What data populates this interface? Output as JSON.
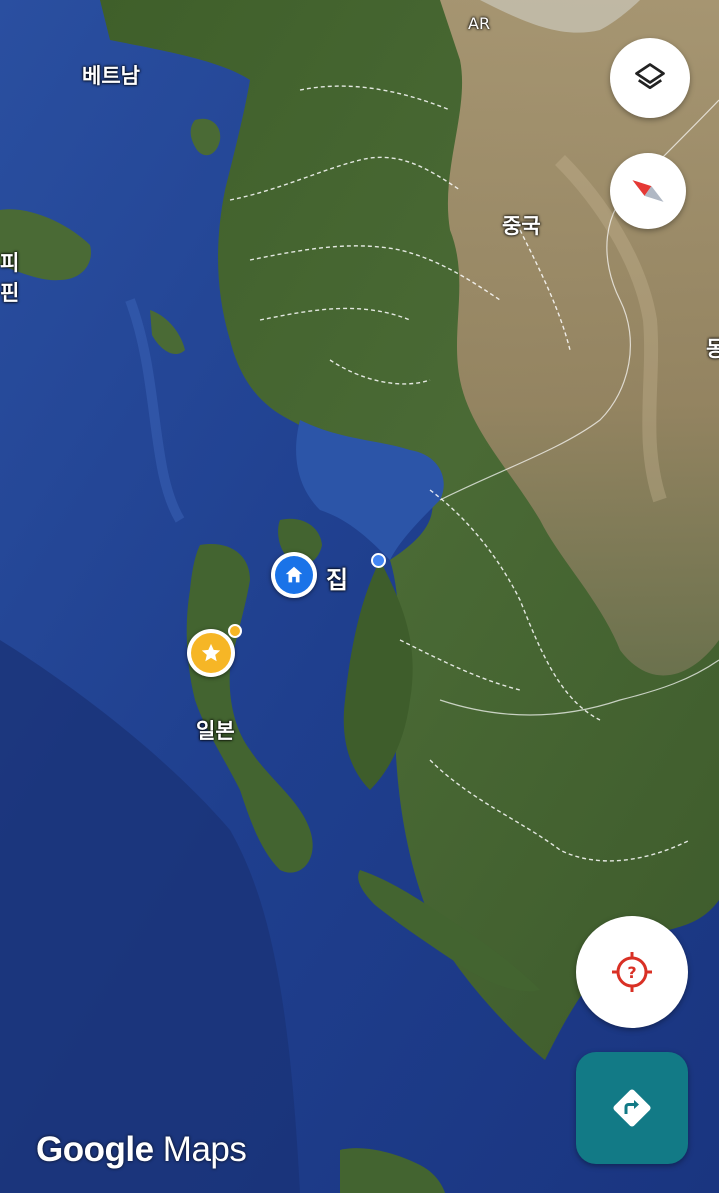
{
  "map": {
    "type": "satellite",
    "labels": {
      "vietnam": "베트남",
      "philippines_partial": "피핀",
      "china": "중국",
      "japan": "일본",
      "top_code": "AR",
      "home": "집",
      "edge_partial": "몽"
    },
    "markers": [
      {
        "name": "home-marker",
        "icon": "home-icon",
        "color": "#1a73e8"
      },
      {
        "name": "starred-place-marker",
        "icon": "star-icon",
        "color": "#f6b626"
      },
      {
        "name": "current-location-dot",
        "icon": "location-dot",
        "color": "#4285f4"
      }
    ]
  },
  "controls": {
    "layers_button": {
      "icon": "layers-icon"
    },
    "compass_button": {
      "icon": "compass-icon"
    },
    "my_location_button": {
      "icon": "location-unknown-icon",
      "color": "#d93025"
    },
    "directions_button": {
      "icon": "directions-icon",
      "color": "#127a86"
    }
  },
  "branding": {
    "logo_google": "Google",
    "logo_maps": "Maps"
  }
}
